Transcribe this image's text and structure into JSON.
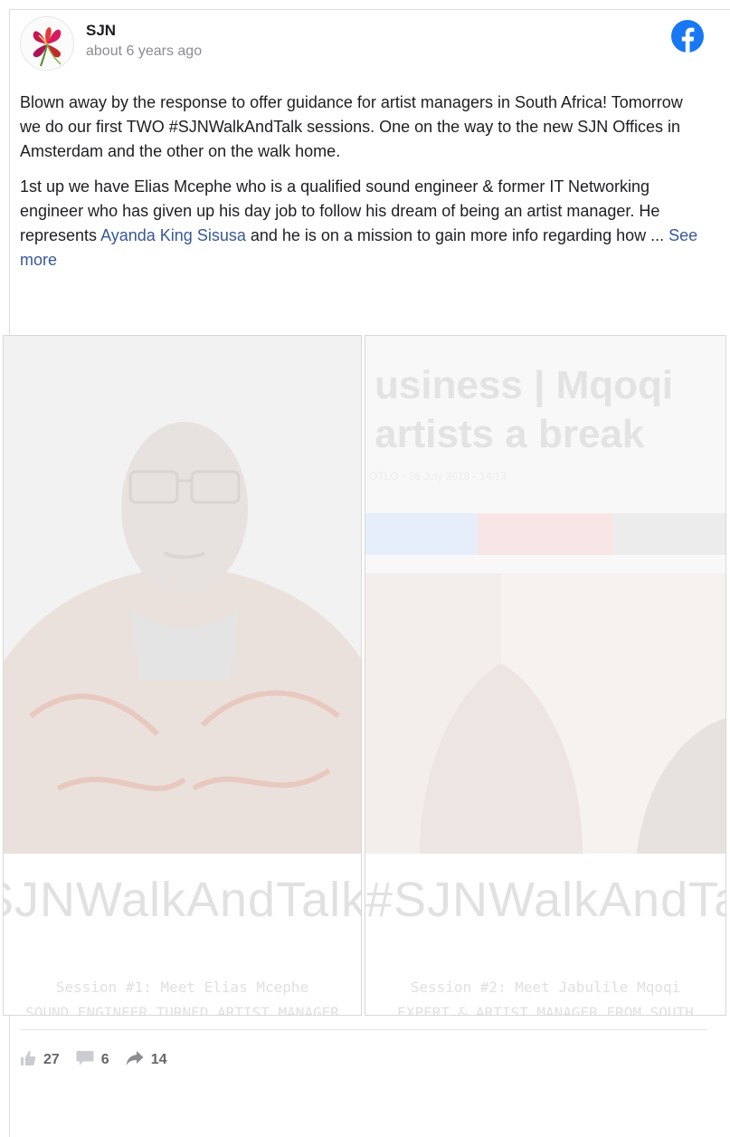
{
  "post": {
    "author": "SJN",
    "time": "about 6 years ago",
    "paragraph1": "Blown away by the response to offer guidance for artist managers in South Africa! Tomorrow we do our first TWO #SJNWalkAndTalk sessions. One on the way to the new SJN Offices in Amsterdam and the other on the walk home.",
    "paragraph2_a": " 1st up we have Elias Mcephe who is a qualified sound engineer & former IT Networking engineer who has given up his day job to follow his dream of being an artist manager. He represents ",
    "mention": "Ayanda King Sisusa",
    "paragraph2_b": " and he is on a mission to gain more info regarding how ... ",
    "see_more": "See more"
  },
  "gallery": {
    "tile1": {
      "hashtag": "SJNWalkAndTalk",
      "session": "Session #1: Meet Elias Mcephe",
      "subtitle": "SOUND ENGINEER TURNED ARTIST MANAGER"
    },
    "tile2": {
      "headline_line1": "usiness | Mqoqi",
      "headline_line2": "artists a break",
      "byline": "OTLO - 26 July 2018 - 14:13",
      "hashtag": "#SJNWalkAndTalk",
      "session": "Session #2: Meet Jabulile Mqoqi",
      "subtitle": "EXPERT & ARTIST MANAGER FROM SOUTH"
    }
  },
  "stats": {
    "likes": "27",
    "comments": "6",
    "shares": "14"
  },
  "colors": {
    "facebook_blue": "#1877f2",
    "link": "#385898",
    "muted": "#8a8d91"
  },
  "icons": [
    "avatar-lily-image",
    "facebook-icon",
    "like-icon",
    "comment-icon",
    "share-icon"
  ]
}
